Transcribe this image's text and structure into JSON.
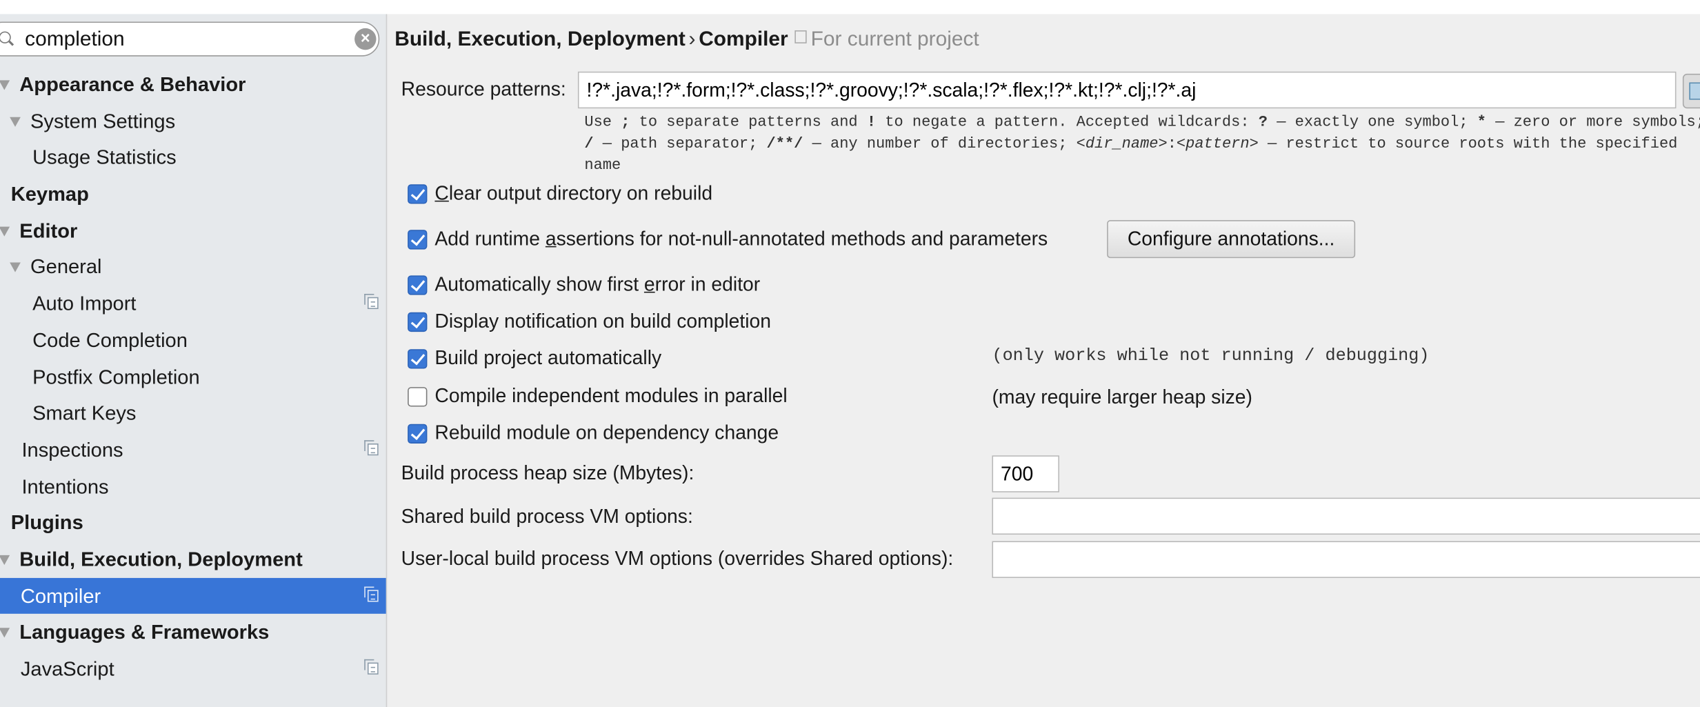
{
  "search": {
    "value": "completion"
  },
  "sidebar": {
    "items": [
      {
        "label": "Appearance & Behavior"
      },
      {
        "label": "System Settings"
      },
      {
        "label": "Usage Statistics"
      },
      {
        "label": "Keymap"
      },
      {
        "label": "Editor"
      },
      {
        "label": "General"
      },
      {
        "label": "Auto Import"
      },
      {
        "label": "Code Completion"
      },
      {
        "label": "Postfix Completion"
      },
      {
        "label": "Smart Keys"
      },
      {
        "label": "Inspections"
      },
      {
        "label": "Intentions"
      },
      {
        "label": "Plugins"
      },
      {
        "label": "Build, Execution, Deployment"
      },
      {
        "label": "Compiler",
        "selected": true
      },
      {
        "label": "Languages & Frameworks"
      },
      {
        "label": "JavaScript"
      }
    ]
  },
  "header": {
    "crumb_parent": "Build, Execution, Deployment",
    "separator": "›",
    "crumb_current": "Compiler",
    "scope": "For current project"
  },
  "resource": {
    "label": "Resource patterns:",
    "value": "!?*.java;!?*.form;!?*.class;!?*.groovy;!?*.scala;!?*.flex;!?*.kt;!?*.clj;!?*.aj",
    "help": {
      "l1a": "Use ",
      "l1b": ";",
      "l1c": " to separate patterns and ",
      "l1d": "!",
      "l1e": " to negate a pattern. Accepted wildcards: ",
      "l1f": "?",
      "l1g": " — exactly one symbol; ",
      "l1h": "*",
      "l1i": " — zero or more symbols;",
      "l2a": "/",
      "l2b": " — path separator; ",
      "l2c": "/**/",
      "l2d": " — any number of directories; ",
      "l2e": "<dir_name>",
      "l2f": ":",
      "l2g": "<pattern>",
      "l2h": " — restrict to source roots with the specified",
      "l3": "name"
    }
  },
  "options": [
    {
      "pre": "",
      "mn": "C",
      "post": "lear output directory on rebuild",
      "checked": true
    },
    {
      "pre": "Add runtime ",
      "mn": "a",
      "post": "ssertions for not-null-annotated methods and parameters",
      "checked": true
    },
    {
      "pre": "Automatically show first ",
      "mn": "e",
      "post": "rror in editor",
      "checked": true
    },
    {
      "pre": "Display notification on build completion",
      "mn": "",
      "post": "",
      "checked": true
    },
    {
      "pre": "Build project automatically",
      "mn": "",
      "post": "",
      "checked": true
    },
    {
      "pre": "Compile independent modules in parallel",
      "mn": "",
      "post": "",
      "checked": false
    },
    {
      "pre": "Rebuild module on dependency change",
      "mn": "",
      "post": "",
      "checked": true
    }
  ],
  "configure_button": "Configure annotations...",
  "notes": {
    "auto_build": "(only works while not running / debugging)",
    "parallel": "(may require larger heap size)"
  },
  "heap": {
    "label": "Build process heap size (Mbytes):",
    "value": "700"
  },
  "shared_vm": {
    "label": "Shared build process VM options:",
    "value": ""
  },
  "user_vm": {
    "label": "User-local build process VM options (overrides Shared options):",
    "value": ""
  },
  "colors": {
    "selection": "#3875d7",
    "checkbox": "#3a78d6",
    "sidebar_bg": "#e6e9ec",
    "panel_bg": "#efefef"
  }
}
